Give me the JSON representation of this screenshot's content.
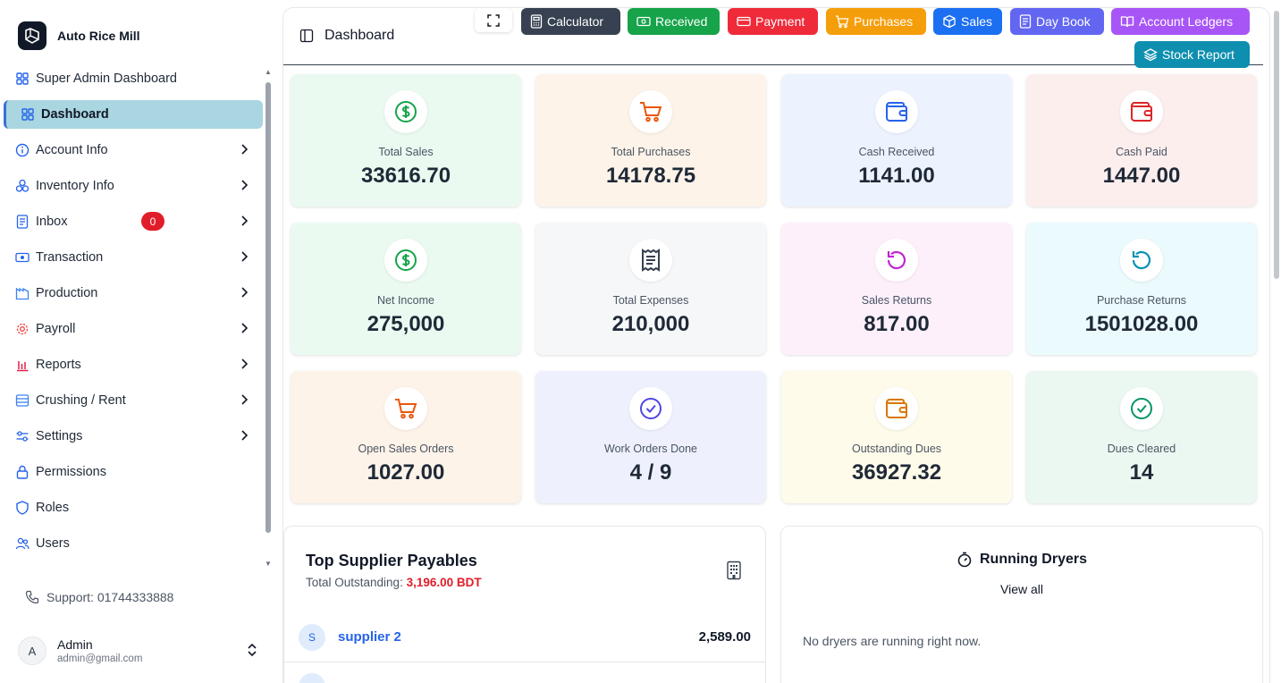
{
  "brand": {
    "name": "Auto Rice Mill"
  },
  "sidebar": {
    "items": [
      {
        "label": "Super Admin Dashboard",
        "icon": "grid-icon",
        "chevron": false
      },
      {
        "label": "Dashboard",
        "icon": "grid-icon",
        "chevron": false,
        "active": true
      },
      {
        "label": "Account Info",
        "icon": "info-icon",
        "chevron": true
      },
      {
        "label": "Inventory Info",
        "icon": "boxes-icon",
        "chevron": true
      },
      {
        "label": "Inbox",
        "icon": "document-icon",
        "chevron": true,
        "badge": "0"
      },
      {
        "label": "Transaction",
        "icon": "banknote-icon",
        "chevron": true
      },
      {
        "label": "Production",
        "icon": "factory-icon",
        "chevron": true
      },
      {
        "label": "Payroll",
        "icon": "gear-icon",
        "chevron": true
      },
      {
        "label": "Reports",
        "icon": "bar-chart-icon",
        "chevron": true
      },
      {
        "label": "Crushing / Rent",
        "icon": "database-icon",
        "chevron": true
      },
      {
        "label": "Settings",
        "icon": "sliders-icon",
        "chevron": true
      },
      {
        "label": "Permissions",
        "icon": "lock-icon",
        "chevron": false
      },
      {
        "label": "Roles",
        "icon": "shield-icon",
        "chevron": false
      },
      {
        "label": "Users",
        "icon": "users-icon",
        "chevron": false
      }
    ],
    "support": "Support: 01744333888",
    "user": {
      "initial": "A",
      "name": "Admin",
      "email": "admin@gmail.com"
    }
  },
  "header": {
    "title": "Dashboard",
    "buttons": [
      {
        "label": "Calculator",
        "color": "#374151"
      },
      {
        "label": "Received",
        "color": "#16a34a"
      },
      {
        "label": "Payment",
        "color": "#ef2b3a"
      },
      {
        "label": "Purchases",
        "color": "#f59e0b"
      },
      {
        "label": "Sales",
        "color": "#1d6ff2"
      },
      {
        "label": "Day Book",
        "color": "#6366f1"
      },
      {
        "label": "Account Ledgers",
        "color": "#a855f7"
      },
      {
        "label": "Stock Report",
        "color": "#0e8fb0"
      }
    ]
  },
  "cards": [
    {
      "label": "Total Sales",
      "value": "33616.70",
      "bg": "#eafaf1",
      "icon": "dollar-icon",
      "icon_color": "#16a34a"
    },
    {
      "label": "Total Purchases",
      "value": "14178.75",
      "bg": "#fdf3e9",
      "icon": "cart-icon",
      "icon_color": "#ea580c"
    },
    {
      "label": "Cash Received",
      "value": "1141.00",
      "bg": "#ecf3fe",
      "icon": "wallet-icon",
      "icon_color": "#2563eb"
    },
    {
      "label": "Cash Paid",
      "value": "1447.00",
      "bg": "#fdeeee",
      "icon": "wallet-icon",
      "icon_color": "#dc2626"
    },
    {
      "label": "Net Income",
      "value": "275,000",
      "bg": "#eafaf1",
      "icon": "dollar-icon",
      "icon_color": "#16a34a"
    },
    {
      "label": "Total Expenses",
      "value": "210,000",
      "bg": "#f6f7f9",
      "icon": "receipt-icon",
      "icon_color": "#374151"
    },
    {
      "label": "Sales Returns",
      "value": "817.00",
      "bg": "#fdf0fb",
      "icon": "rotate-icon",
      "icon_color": "#c026d3"
    },
    {
      "label": "Purchase Returns",
      "value": "1501028.00",
      "bg": "#ebfafc",
      "icon": "rotate-icon",
      "icon_color": "#0891b2"
    },
    {
      "label": "Open Sales Orders",
      "value": "1027.00",
      "bg": "#fdf3e9",
      "icon": "cart-icon",
      "icon_color": "#ea580c"
    },
    {
      "label": "Work Orders Done",
      "value": "4 / 9",
      "bg": "#eef1fd",
      "icon": "check-circle-icon",
      "icon_color": "#4f46e5"
    },
    {
      "label": "Outstanding Dues",
      "value": "36927.32",
      "bg": "#fefbea",
      "icon": "wallet-icon",
      "icon_color": "#d97706"
    },
    {
      "label": "Dues Cleared",
      "value": "14",
      "bg": "#ebf8f1",
      "icon": "check-circle-icon",
      "icon_color": "#059669"
    }
  ],
  "suppliers": {
    "title": "Top Supplier Payables",
    "outstanding_label": "Total Outstanding:",
    "outstanding_value": "3,196.00 BDT",
    "rows": [
      {
        "initial": "S",
        "name": "supplier 2",
        "amount": "2,589.00"
      }
    ]
  },
  "dryers": {
    "title": "Running Dryers",
    "view_all": "View all",
    "empty": "No dryers are running right now."
  }
}
